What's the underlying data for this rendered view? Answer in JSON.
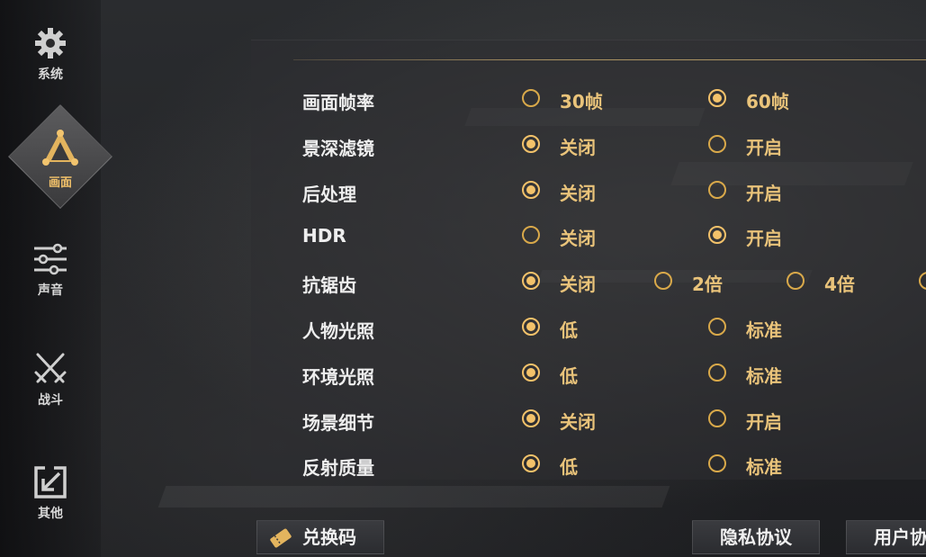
{
  "colors": {
    "accent": "#f3c26a",
    "option_text": "#e9c37a"
  },
  "sidebar": {
    "items": [
      {
        "key": "system",
        "label": "系统",
        "icon": "gear-icon"
      },
      {
        "key": "graphics",
        "label": "画面",
        "icon": "triangle-nodes-icon",
        "active": true
      },
      {
        "key": "sound",
        "label": "声音",
        "icon": "sliders-icon"
      },
      {
        "key": "combat",
        "label": "战斗",
        "icon": "crossed-swords-icon"
      },
      {
        "key": "other",
        "label": "其他",
        "icon": "arrow-box-icon"
      }
    ]
  },
  "settings": [
    {
      "label": "画面帧率",
      "options": [
        "30帧",
        "60帧"
      ],
      "selected": 1
    },
    {
      "label": "景深滤镜",
      "options": [
        "关闭",
        "开启"
      ],
      "selected": 0
    },
    {
      "label": "后处理",
      "options": [
        "关闭",
        "开启"
      ],
      "selected": 0
    },
    {
      "label": "HDR",
      "options": [
        "关闭",
        "开启"
      ],
      "selected": 1
    },
    {
      "label": "抗锯齿",
      "options": [
        "关闭",
        "2倍",
        "4倍"
      ],
      "selected": 0
    },
    {
      "label": "人物光照",
      "options": [
        "低",
        "标准"
      ],
      "selected": 0
    },
    {
      "label": "环境光照",
      "options": [
        "低",
        "标准"
      ],
      "selected": 0
    },
    {
      "label": "场景细节",
      "options": [
        "关闭",
        "开启"
      ],
      "selected": 0
    },
    {
      "label": "反射质量",
      "options": [
        "低",
        "标准"
      ],
      "selected": 0
    }
  ],
  "footer": {
    "redeem_label": "兑换码",
    "privacy_label": "隐私协议",
    "user_agreement_label": "用户协"
  }
}
